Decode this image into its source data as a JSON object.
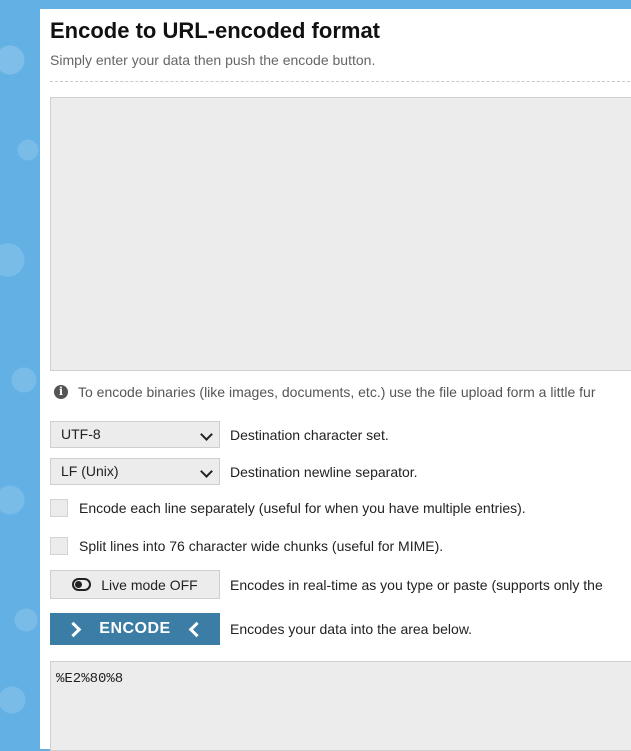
{
  "header": {
    "title": "Encode to URL-encoded format",
    "subtitle": "Simply enter your data then push the encode button."
  },
  "input": {
    "value": ""
  },
  "note": {
    "icon": "info-icon",
    "text": "To encode binaries (like images, documents, etc.) use the file upload form a little fur"
  },
  "options": {
    "charset": {
      "selected": "UTF-8",
      "label": "Destination character set."
    },
    "newline": {
      "selected": "LF (Unix)",
      "label": "Destination newline separator."
    },
    "each_line": {
      "checked": false,
      "label": "Encode each line separately (useful for when you have multiple entries)."
    },
    "split_lines": {
      "checked": false,
      "label": "Split lines into 76 character wide chunks (useful for MIME)."
    },
    "live_mode": {
      "button_label": "Live mode OFF",
      "description": "Encodes in real-time as you type or paste (supports only the"
    }
  },
  "encode": {
    "button_label": "ENCODE",
    "description": "Encodes your data into the area below."
  },
  "output": {
    "value": "%E2%80%8"
  },
  "colors": {
    "background": "#62b0e4",
    "encode_button": "#3c7da6",
    "field_bg": "#ececec"
  }
}
